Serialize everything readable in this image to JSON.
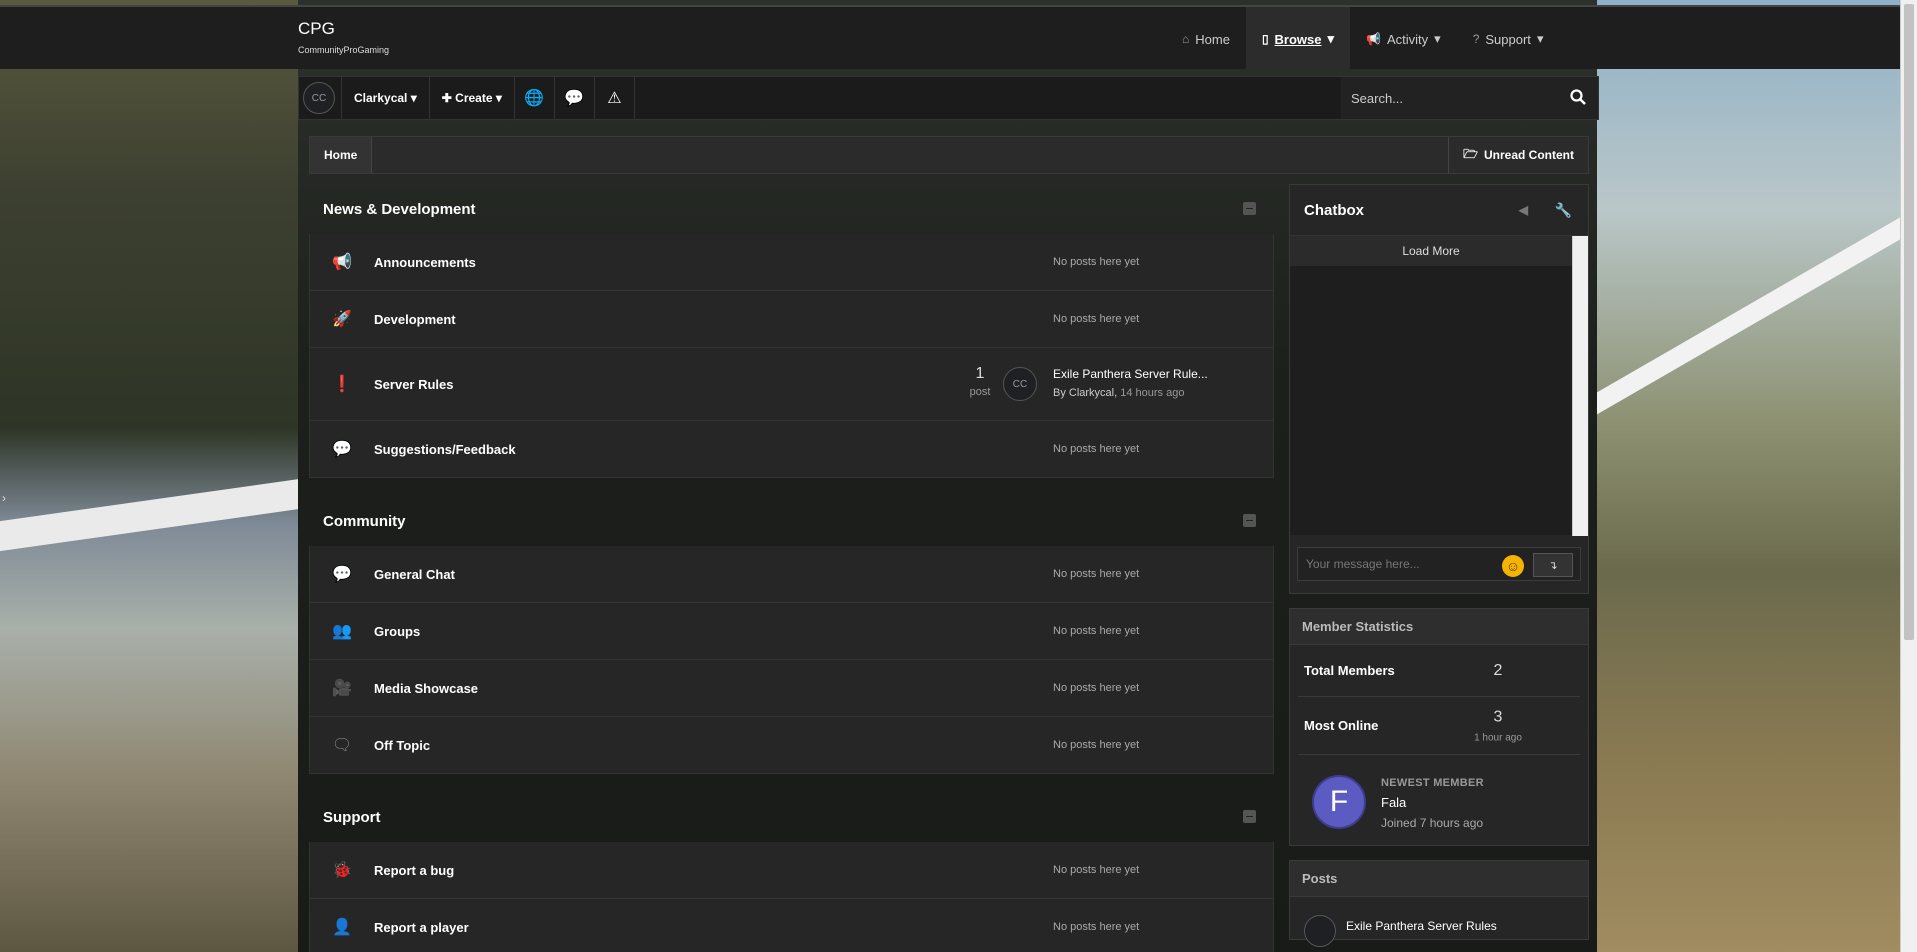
{
  "brand": {
    "title": "CPG",
    "subtitle": "CommunityProGaming"
  },
  "main_nav": [
    {
      "label": "Home",
      "icon": "home-icon"
    },
    {
      "label": "Browse",
      "icon": "file-icon",
      "active": true
    },
    {
      "label": "Activity",
      "icon": "megaphone-icon"
    },
    {
      "label": "Support",
      "icon": "help-icon"
    }
  ],
  "user_bar": {
    "avatar": "CC",
    "username": "Clarkycal",
    "create_label": "Create",
    "search_placeholder": "Search..."
  },
  "breadcrumb": {
    "home": "Home",
    "unread": "Unread Content"
  },
  "categories": [
    {
      "title": "News & Development",
      "forums": [
        {
          "name": "Announcements",
          "icon": "megaphone-icon",
          "status": "No posts here yet"
        },
        {
          "name": "Development",
          "icon": "rocket-icon",
          "status": "No posts here yet"
        },
        {
          "name": "Server Rules",
          "icon": "exclamation-icon",
          "count": "1",
          "count_label": "post",
          "last_avatar": "CC",
          "last_title": "Exile Panthera Server Rule...",
          "last_by": "By Clarkycal,",
          "last_time": "14 hours ago"
        },
        {
          "name": "Suggestions/Feedback",
          "icon": "comment-icon",
          "status": "No posts here yet"
        }
      ]
    },
    {
      "title": "Community",
      "forums": [
        {
          "name": "General Chat",
          "icon": "comment-icon",
          "status": "No posts here yet"
        },
        {
          "name": "Groups",
          "icon": "users-icon",
          "status": "No posts here yet"
        },
        {
          "name": "Media Showcase",
          "icon": "video-icon",
          "status": "No posts here yet"
        },
        {
          "name": "Off Topic",
          "icon": "comments-icon",
          "status": "No posts here yet"
        }
      ]
    },
    {
      "title": "Support",
      "forums": [
        {
          "name": "Report a bug",
          "icon": "bug-icon",
          "status": "No posts here yet"
        },
        {
          "name": "Report a player",
          "icon": "user-icon",
          "status": "No posts here yet"
        }
      ]
    }
  ],
  "chatbox": {
    "title": "Chatbox",
    "load_more": "Load More",
    "input_placeholder": "Your message here..."
  },
  "member_stats": {
    "title": "Member Statistics",
    "total_label": "Total Members",
    "total_value": "2",
    "online_label": "Most Online",
    "online_value": "3",
    "online_time": "1 hour ago",
    "newest_label": "NEWEST MEMBER",
    "newest_initial": "F",
    "newest_name": "Fala",
    "newest_joined": "Joined 7 hours ago"
  },
  "posts": {
    "title": "Posts",
    "first_title": "Exile Panthera Server Rules"
  },
  "colors": {
    "accent_avatar": "#5b5bc1",
    "emoji": "#f4b400"
  }
}
